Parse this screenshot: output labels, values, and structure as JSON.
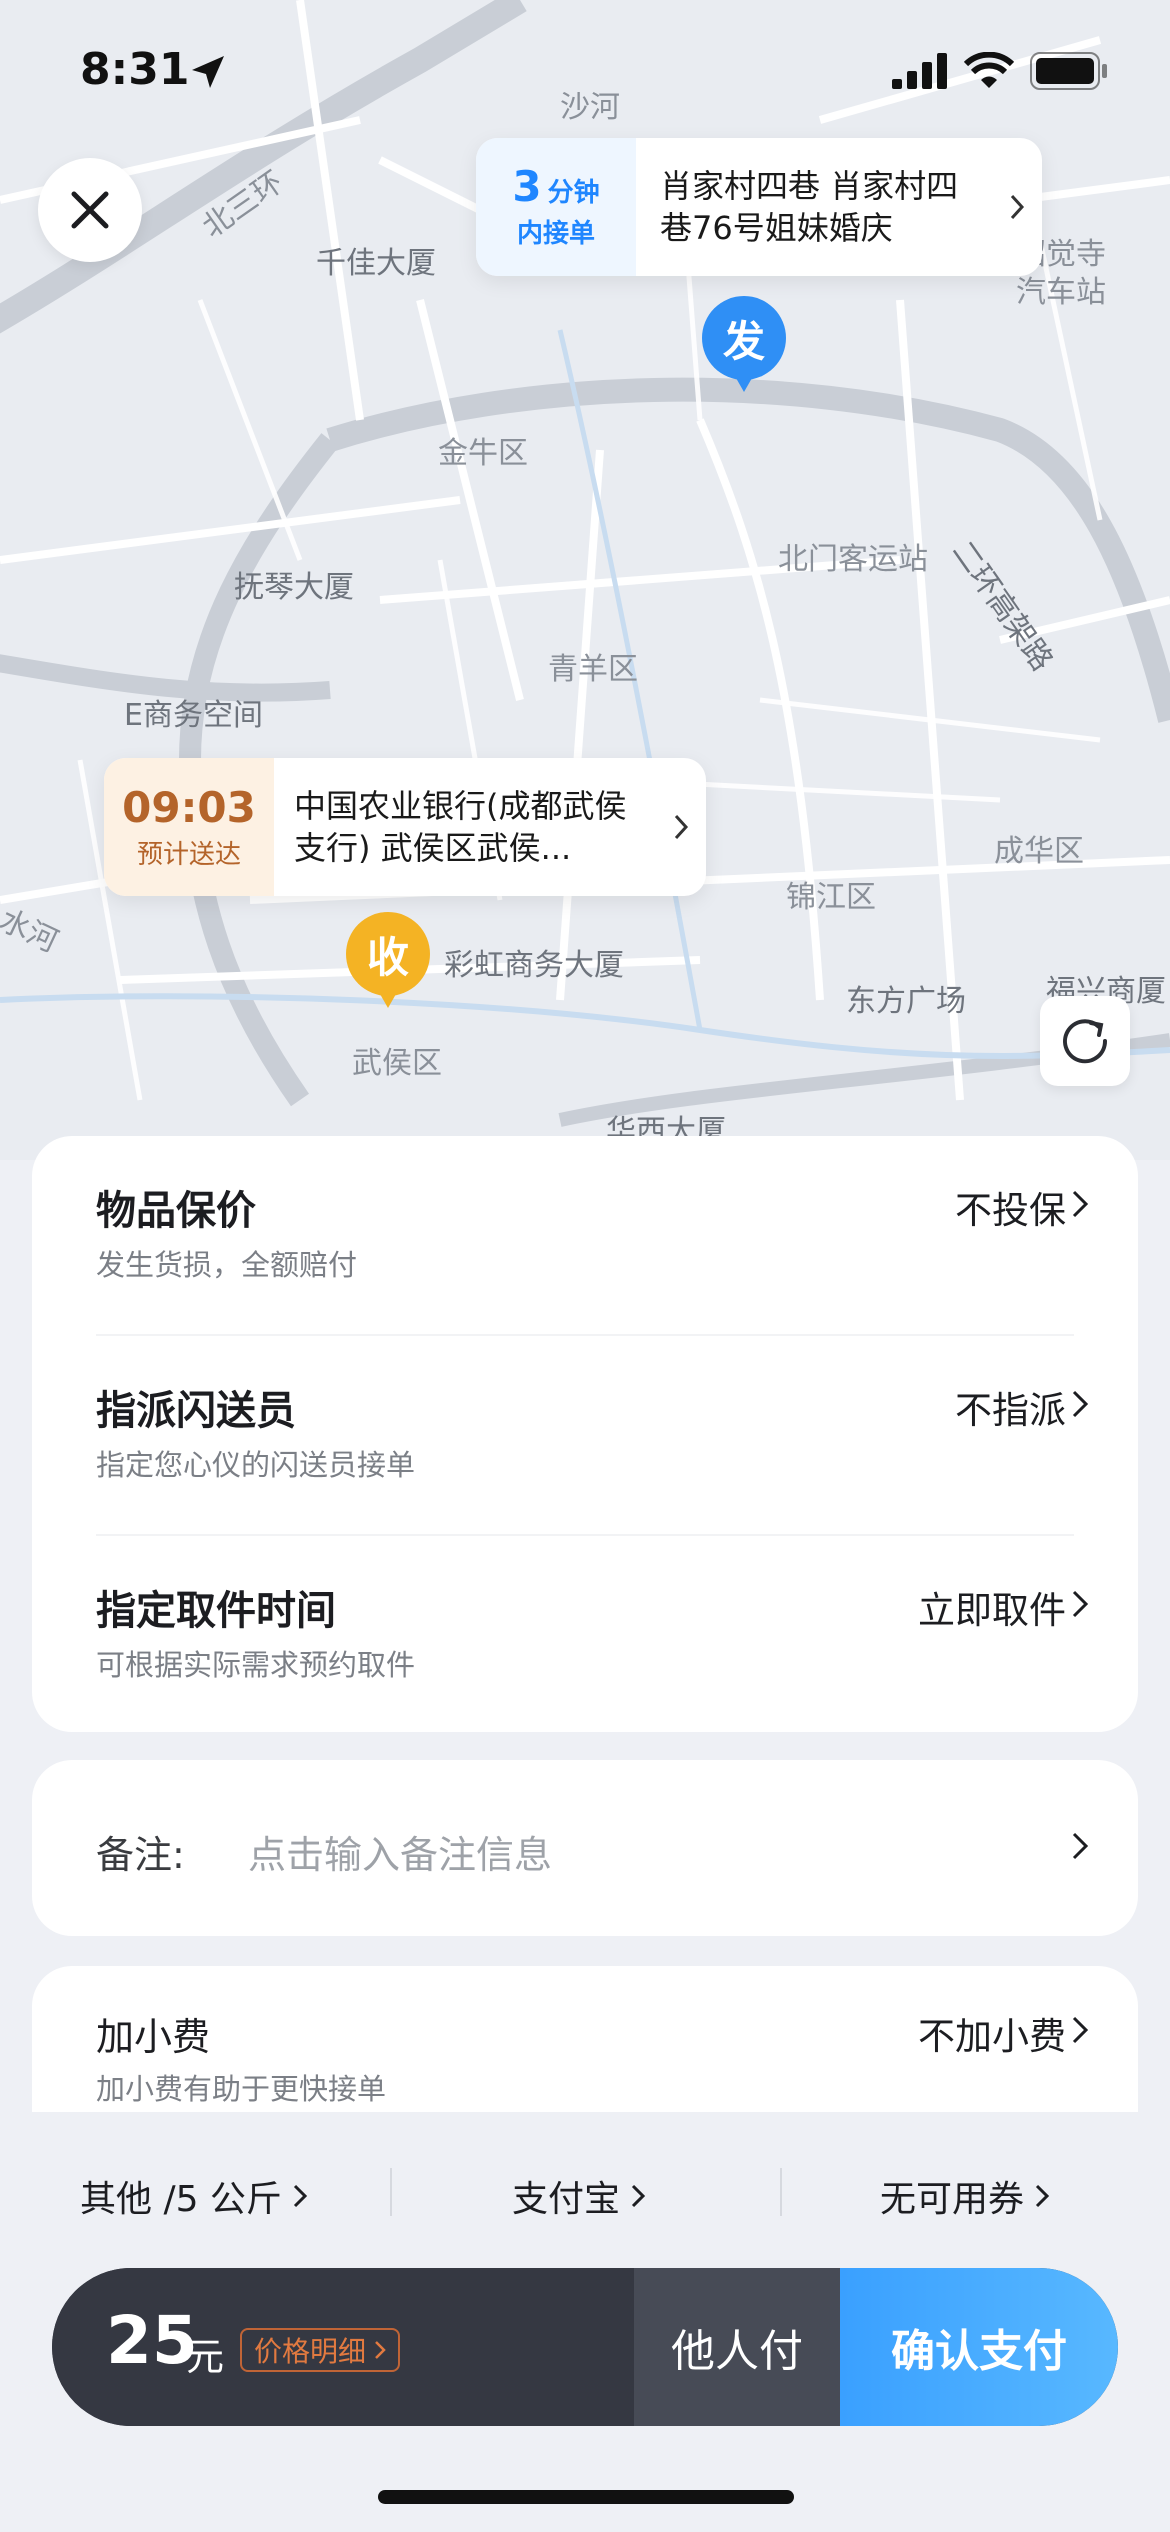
{
  "status_bar": {
    "time": "8:31"
  },
  "map": {
    "labels": {
      "shahe": "沙河",
      "beisanhuan": "北三环",
      "qianjia": "千佳大厦",
      "jinniu": "金牛区",
      "fuqin": "抚琴大厦",
      "beimen": "北门客运站",
      "qingyang": "青羊区",
      "eshang": "E商务空间",
      "zhaojue": "昭觉寺\n汽车站",
      "erhuan": "二环高架路",
      "chenghua": "成华区",
      "jinjiang": "锦江区",
      "caihong": "彩虹商务大厦",
      "dongfang": "东方广场",
      "fuxing": "福兴商厦",
      "wuhou": "武侯区",
      "huaxi": "华西大厦",
      "shuihe": "水河"
    }
  },
  "pickup": {
    "eta_number": "3",
    "eta_unit": "分钟",
    "eta_suffix": "内接单",
    "address": "肖家村四巷 肖家村四巷76号姐妹婚庆",
    "pin_label": "发"
  },
  "dropoff": {
    "eta_time": "09:03",
    "eta_label": "预计送达",
    "address": "中国农业银行(成都武侯支行) 武侯区武侯...",
    "pin_label": "收"
  },
  "options": [
    {
      "title": "物品保价",
      "subtitle": "发生货损，全额赔付",
      "value": "不投保"
    },
    {
      "title": "指派闪送员",
      "subtitle": "指定您心仪的闪送员接单",
      "value": "不指派"
    },
    {
      "title": "指定取件时间",
      "subtitle": "可根据实际需求预约取件",
      "value": "立即取件"
    }
  ],
  "note": {
    "label": "备注:",
    "placeholder": "点击输入备注信息"
  },
  "tip": {
    "title": "加小费",
    "subtitle": "加小费有助于更快接单",
    "value": "不加小费"
  },
  "summary": {
    "item_type": "其他 /5 公斤",
    "payment_method": "支付宝",
    "coupon": "无可用券"
  },
  "payment": {
    "amount": "25",
    "unit": "元",
    "detail_label": "价格明细",
    "others_pay": "他人付",
    "confirm": "确认支付"
  },
  "colors": {
    "accent_blue": "#2f8ff5",
    "accent_yellow": "#f4b324",
    "confirm_gradient_start": "#3aa0ff",
    "pay_bar_dark": "#353842",
    "detail_orange": "#e27a40"
  }
}
